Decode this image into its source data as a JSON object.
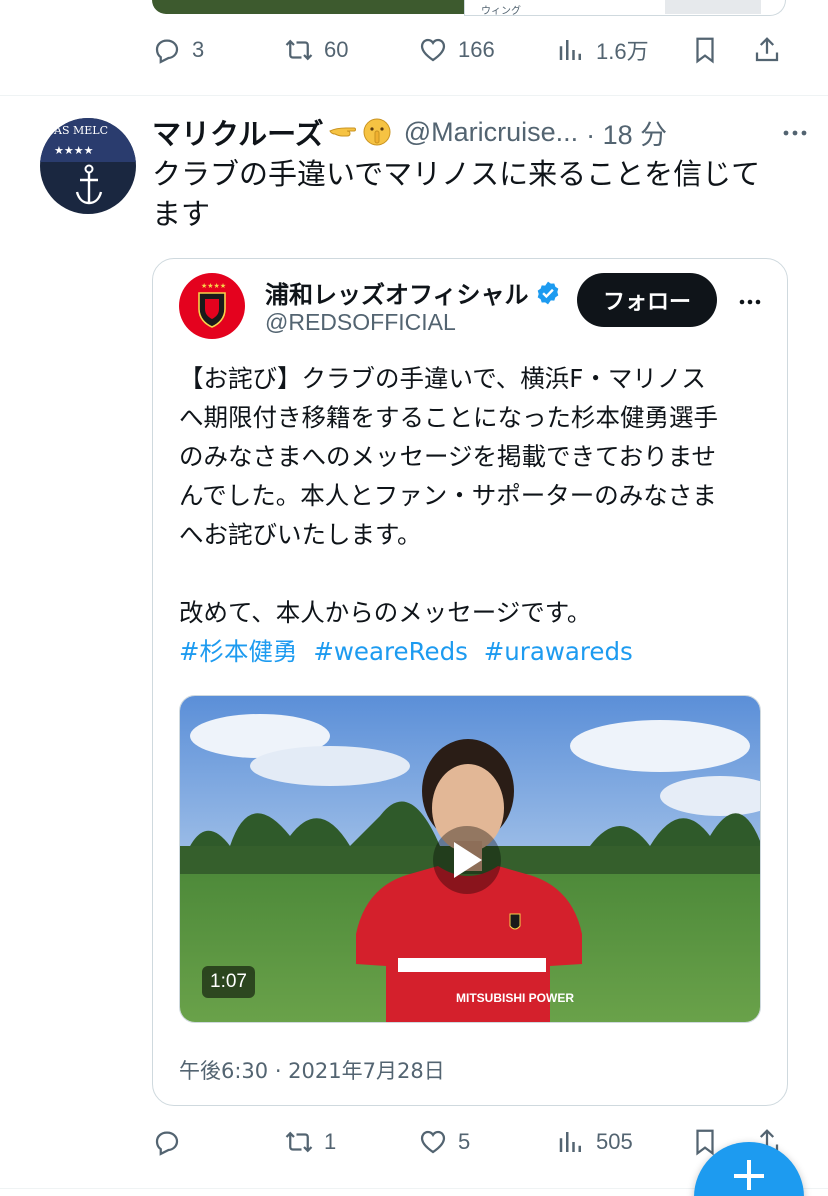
{
  "top_card": {
    "caption": "ウィング"
  },
  "prev_actions": {
    "reply_count": "3",
    "retweet_count": "60",
    "like_count": "166",
    "views_count": "1.6万"
  },
  "tweet": {
    "display_name": "マリクルーズ",
    "handle": "@Maricruise...",
    "time": "· 18 分",
    "text_line1": "クラブの手違いでマリノスに来ることを信じて",
    "text_line2": "ます",
    "avatar_text": "ÂS MELC",
    "avatar_stars": "★★★★"
  },
  "quote": {
    "display_name": "浦和レッズオフィシャル",
    "handle": "@REDSOFFICIAL",
    "follow_label": "フォロー",
    "lines": [
      "【お詫び】クラブの手違いで、横浜F・マリノス",
      "へ期限付き移籍をすることになった杉本健勇選手",
      "のみなさまへのメッセージを掲載できておりませ",
      "んでした。本人とファン・サポーターのみなさま",
      "へお詫びいたします。",
      "",
      "改めて、本人からのメッセージです。"
    ],
    "hashtags": [
      "#杉本健勇",
      "#weareReds",
      "#urawareds"
    ],
    "video_duration": "1:07",
    "shirt_sponsor": "MITSUBISHI POWER",
    "timestamp": "午後6:30 · 2021年7月28日"
  },
  "tweet_actions": {
    "reply_count": "",
    "retweet_count": "1",
    "like_count": "5",
    "views_count": "505"
  },
  "colors": {
    "accent": "#1d9bf0",
    "text_secondary": "#536471",
    "reds_red": "#e4021e"
  }
}
